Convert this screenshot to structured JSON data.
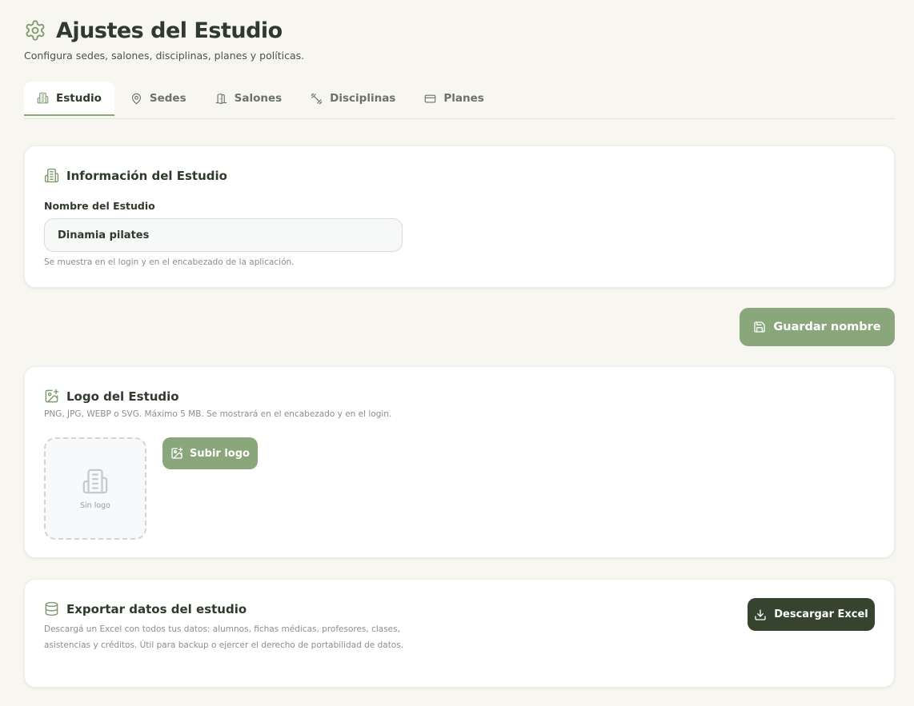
{
  "header": {
    "title": "Ajustes del Estudio",
    "subtitle": "Configura sedes, salones, disciplinas, planes y políticas.",
    "icon": "gear-icon"
  },
  "tabs": [
    {
      "label": "Estudio",
      "icon": "building-icon",
      "active": true
    },
    {
      "label": "Sedes",
      "icon": "map-pin-icon",
      "active": false
    },
    {
      "label": "Salones",
      "icon": "door-icon",
      "active": false
    },
    {
      "label": "Disciplinas",
      "icon": "dumbbell-icon",
      "active": false
    },
    {
      "label": "Planes",
      "icon": "credit-card-icon",
      "active": false
    }
  ],
  "info_card": {
    "title": "Información del Estudio",
    "field_label": "Nombre del Estudio",
    "field_value": "Dinamia pilates",
    "help": "Se muestra en el login y en el encabezado de la aplicación."
  },
  "save_button": {
    "label": "Guardar nombre"
  },
  "logo_card": {
    "title": "Logo del Estudio",
    "description": "PNG, JPG, WEBP o SVG. Máximo 5 MB. Se mostrará en el encabezado y en el login.",
    "placeholder": "Sin logo",
    "upload_label": "Subir logo"
  },
  "export_card": {
    "title": "Exportar datos del estudio",
    "description": "Descargá un Excel con todos tus datos: alumnos, fichas médicas, profesores, clases, asistencias y créditos. Útil para backup o ejercer el derecho de portabilidad de datos.",
    "button_label": "Descargar Excel"
  },
  "colors": {
    "accent": "#8aa77c",
    "icon_green": "#7d9a6d",
    "dark_button": "#35432f",
    "background": "#f7f6f1"
  }
}
